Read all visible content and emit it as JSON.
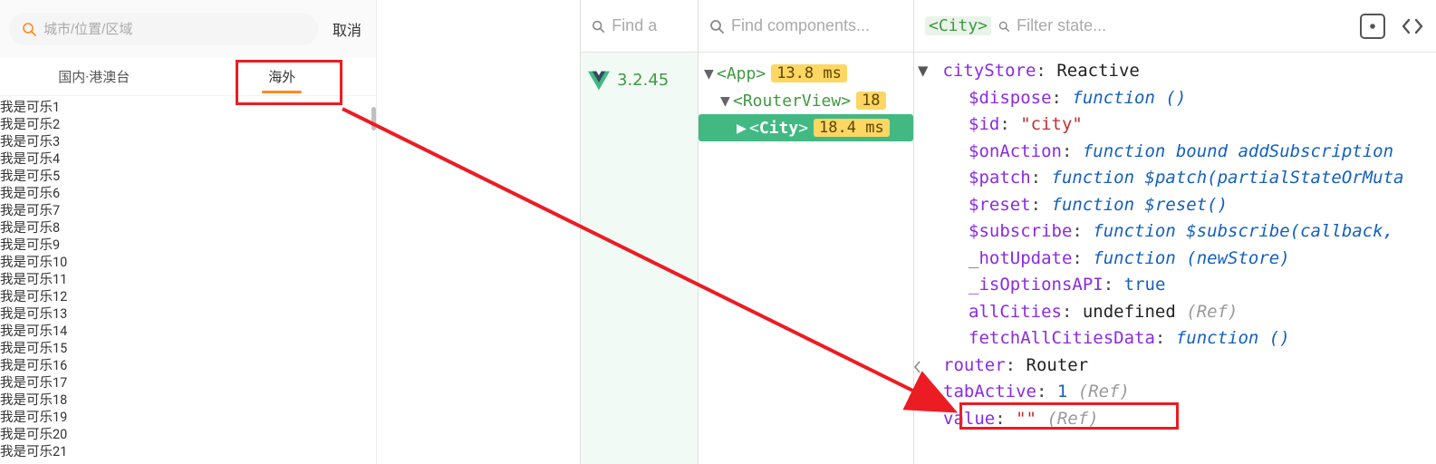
{
  "app": {
    "search_placeholder": "城市/位置/区域",
    "cancel_label": "取消",
    "tabs": {
      "domestic": "国内·港澳台",
      "overseas": "海外"
    },
    "city_items": [
      "我是可乐1",
      "我是可乐2",
      "我是可乐3",
      "我是可乐4",
      "我是可乐5",
      "我是可乐6",
      "我是可乐7",
      "我是可乐8",
      "我是可乐9",
      "我是可乐10",
      "我是可乐11",
      "我是可乐12",
      "我是可乐13",
      "我是可乐14",
      "我是可乐15",
      "我是可乐16",
      "我是可乐17",
      "我是可乐18",
      "我是可乐19",
      "我是可乐20",
      "我是可乐21"
    ]
  },
  "devtools": {
    "find_apps_placeholder": "Find a",
    "find_components_placeholder": "Find components...",
    "filter_state_placeholder": "Filter state...",
    "selected_component_tag": "<City>",
    "vue_version": "3.2.45",
    "tree": {
      "app": {
        "label": "<App>",
        "badge": "13.8 ms"
      },
      "routerview": {
        "label": "<RouterView>",
        "badge": "18"
      },
      "city": {
        "label": "<City>",
        "badge": "18.4 ms"
      }
    },
    "state": {
      "root_key": "cityStore",
      "root_val": "Reactive",
      "rows": [
        {
          "key": "$dispose",
          "kw": "function",
          "id": "()"
        },
        {
          "key": "$id",
          "str": "\"city\""
        },
        {
          "key": "$onAction",
          "kw": "function",
          "id": "bound addSubscription"
        },
        {
          "key": "$patch",
          "kw": "function",
          "id": "$patch(partialStateOrMuta"
        },
        {
          "key": "$reset",
          "kw": "function",
          "id": "$reset()"
        },
        {
          "key": "$subscribe",
          "kw": "function",
          "id": "$subscribe(callback,"
        },
        {
          "key": "_hotUpdate",
          "kw": "function",
          "id": "(newStore)"
        },
        {
          "key": "_isOptionsAPI",
          "bool": "true"
        },
        {
          "key": "allCities",
          "plain": "undefined",
          "anno": "(Ref)"
        },
        {
          "key": "fetchAllCitiesData",
          "kw": "function",
          "id": "()"
        }
      ],
      "router_key": "router",
      "router_val": "Router",
      "tabActive_key": "tabActive",
      "tabActive_val": "1",
      "tabActive_anno": "(Ref)",
      "value_key": "value",
      "value_val": "\"\"",
      "value_anno": "(Ref)"
    }
  }
}
